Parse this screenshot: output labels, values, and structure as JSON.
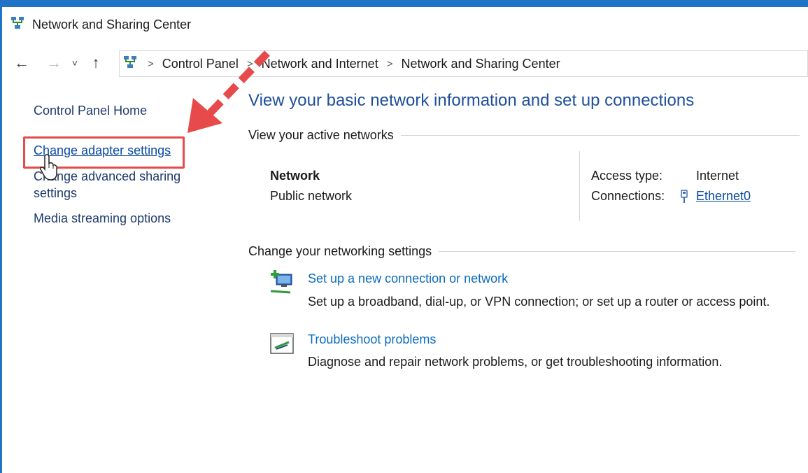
{
  "window": {
    "title": "Network and Sharing Center"
  },
  "nav": {
    "back": "←",
    "forward": "→",
    "recent": "˅",
    "up": "↑"
  },
  "breadcrumb": {
    "items": [
      "Control Panel",
      "Network and Internet",
      "Network and Sharing Center"
    ],
    "separator": ">"
  },
  "sidebar": {
    "items": [
      {
        "label": "Control Panel Home"
      },
      {
        "label": "Change adapter settings"
      },
      {
        "label": "Change advanced sharing"
      },
      {
        "label": "settings"
      },
      {
        "label": "Media streaming options"
      }
    ]
  },
  "main": {
    "title": "View your basic network information and set up connections",
    "active_networks": {
      "heading": "View your active networks",
      "network_name": "Network",
      "network_type": "Public network",
      "access_type_label": "Access type:",
      "access_type_value": "Internet",
      "connections_label": "Connections:",
      "connections_value": "Ethernet0"
    },
    "networking_settings": {
      "heading": "Change your networking settings",
      "tasks": [
        {
          "link": "Set up a new connection or network",
          "desc": "Set up a broadband, dial-up, or VPN connection; or set up a router or access point."
        },
        {
          "link": "Troubleshoot problems",
          "desc": "Diagnose and repair network problems, or get troubleshooting information."
        }
      ]
    }
  },
  "colors": {
    "accent_blue": "#1e4f9a",
    "link_blue": "#0b6bbf",
    "annotation_red": "#e64a4a"
  }
}
